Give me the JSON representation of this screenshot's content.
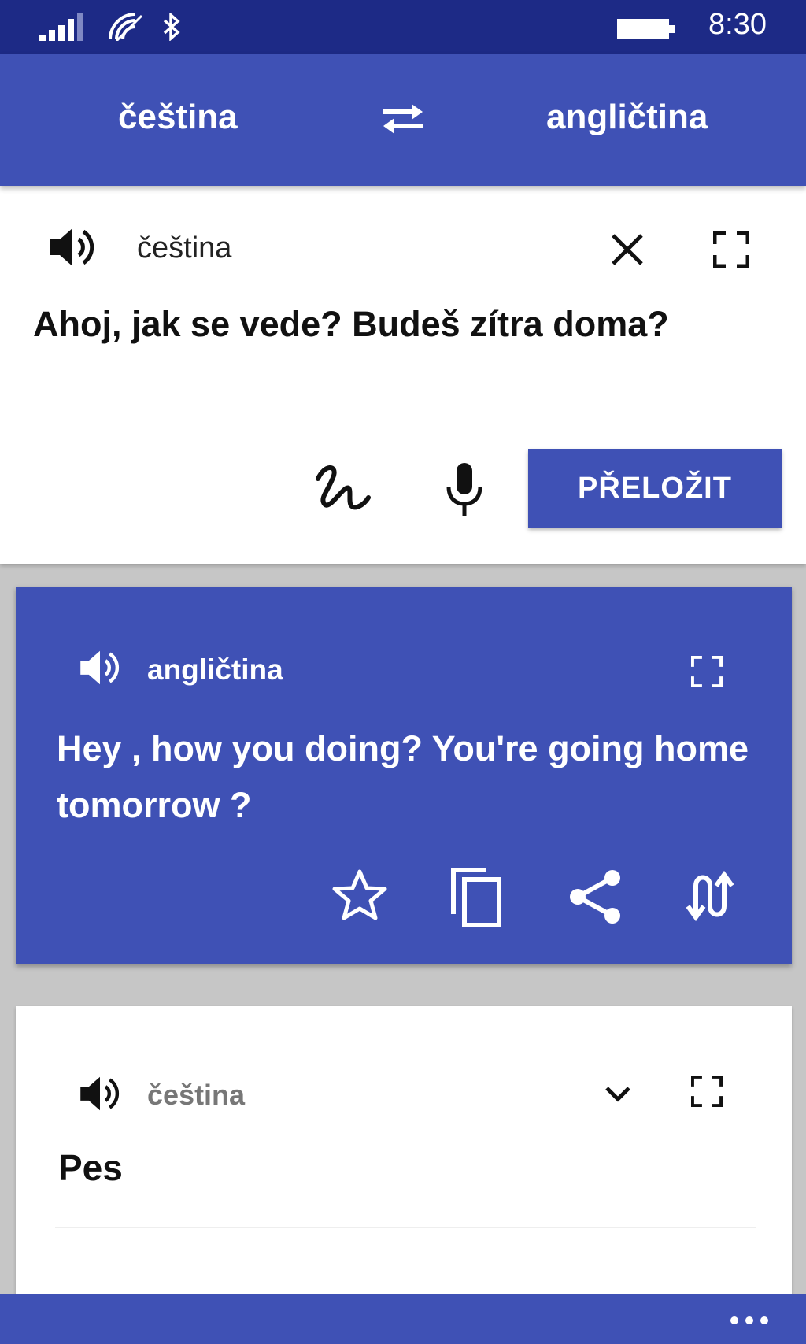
{
  "status_bar": {
    "time": "8:30",
    "icons": [
      "signal-icon",
      "wifi-icon",
      "bluetooth-icon",
      "battery-icon"
    ]
  },
  "language_bar": {
    "source_language": "čeština",
    "target_language": "angličtina",
    "swap_icon": "swap-arrows-icon"
  },
  "input_card": {
    "language": "čeština",
    "text": "Ahoj, jak se vede? Budeš zítra doma?",
    "translate_label": "PŘELOŽIT",
    "icons": [
      "speaker-icon",
      "close-icon",
      "fullscreen-icon",
      "handwriting-icon",
      "microphone-icon"
    ]
  },
  "result_card": {
    "language": "angličtina",
    "text": "Hey , how you doing? You're going home tomorrow ?",
    "icons": [
      "speaker-icon",
      "fullscreen-icon",
      "star-icon",
      "copy-icon",
      "share-icon",
      "reverse-translate-icon"
    ]
  },
  "history": {
    "items": [
      {
        "language": "čeština",
        "text": "Pes"
      }
    ],
    "icons": [
      "speaker-icon",
      "chevron-down-icon",
      "fullscreen-icon"
    ]
  },
  "app_bar": {
    "more_icon": "more-ellipsis-icon"
  },
  "colors": {
    "primary": "#3f51b5",
    "status_bar": "#1d2a86",
    "background": "#c6c6c6",
    "white": "#ffffff"
  }
}
